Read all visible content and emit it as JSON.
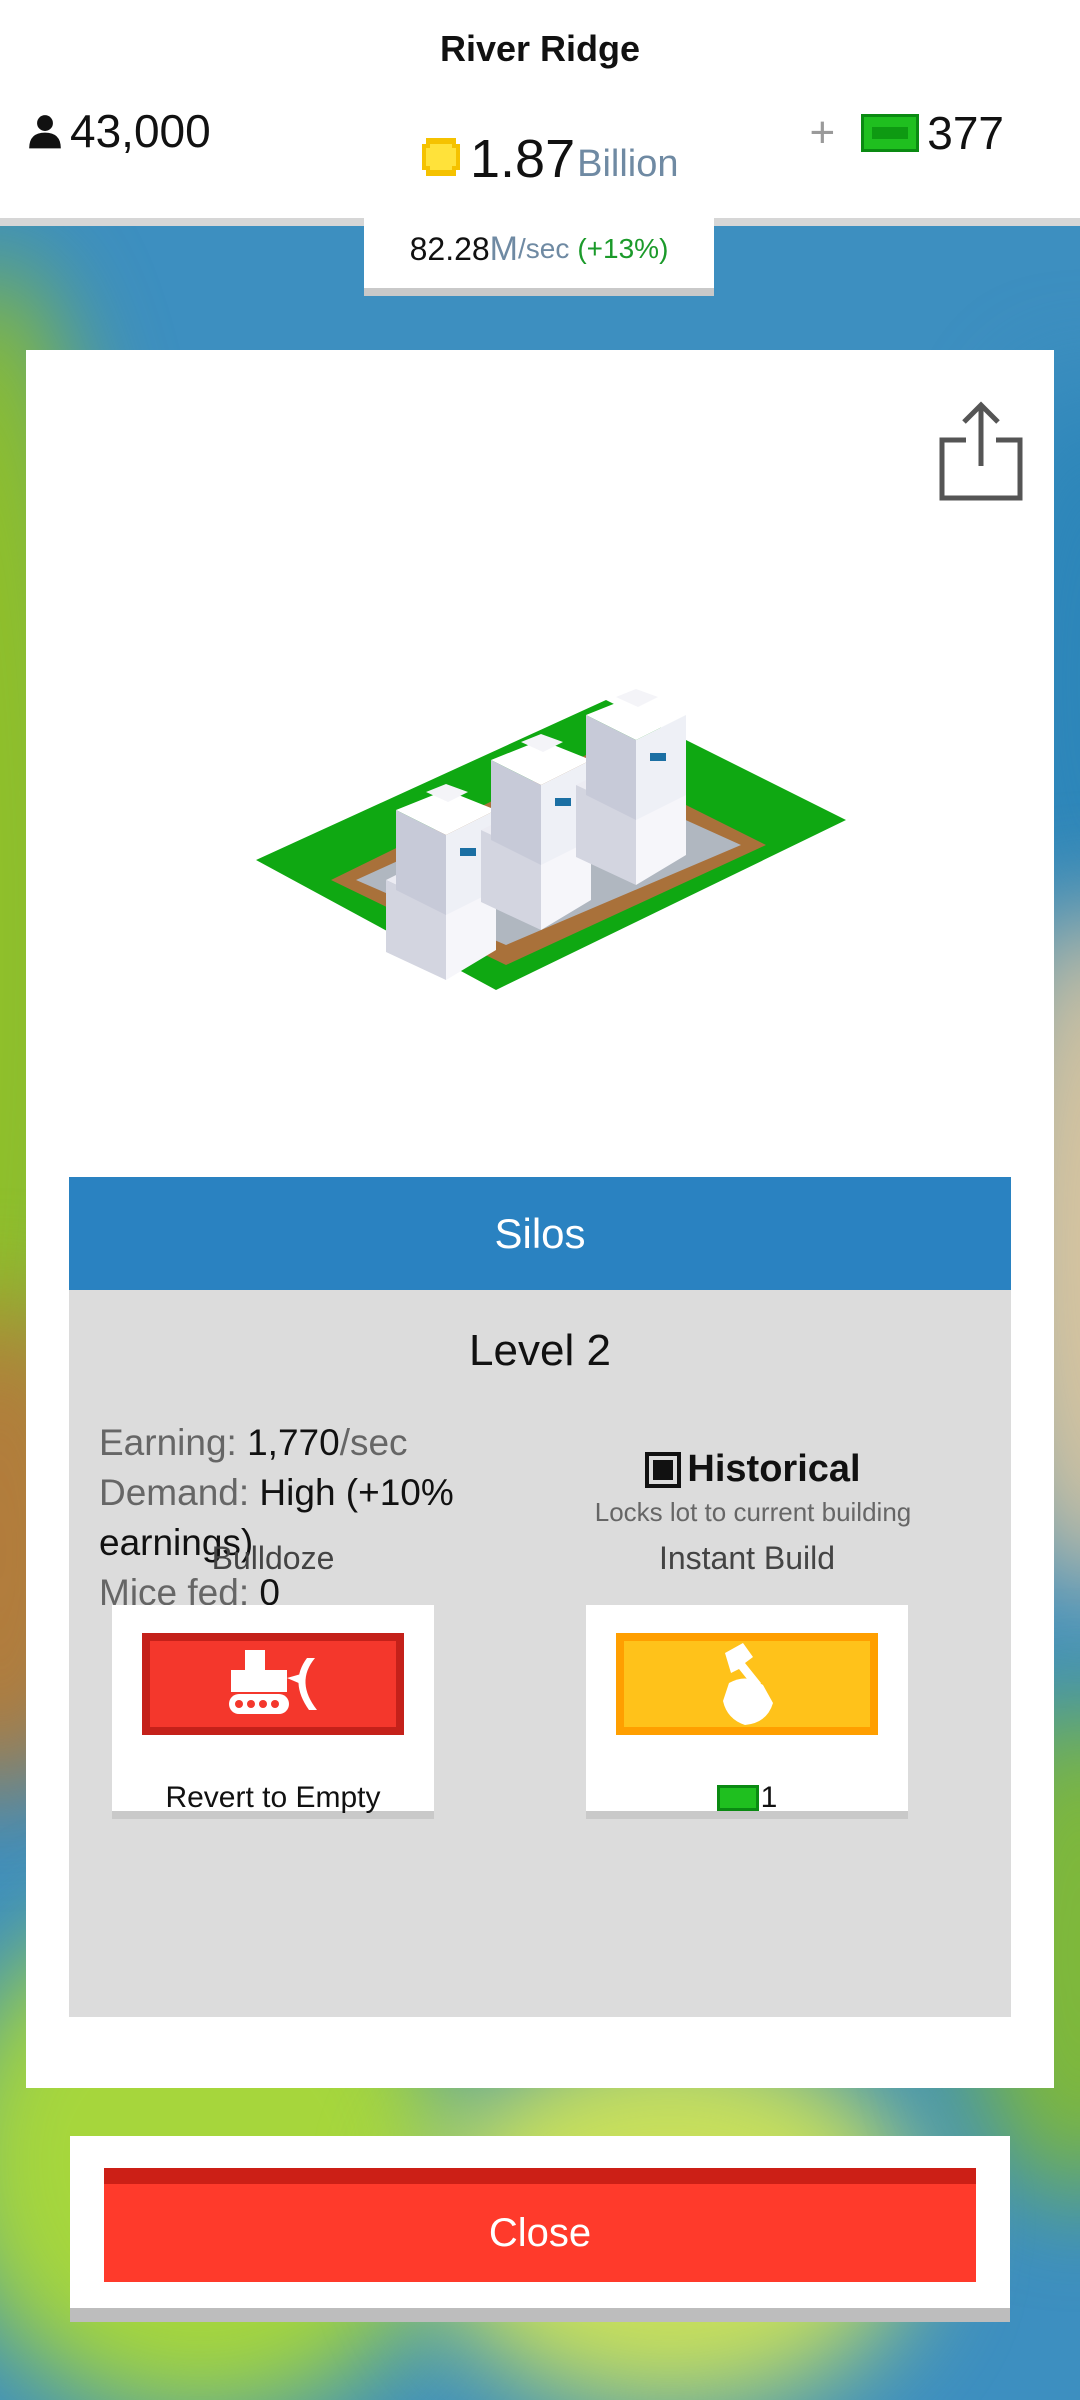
{
  "header": {
    "city_name": "River Ridge",
    "population": "43,000",
    "money_value": "1.87",
    "money_unit": "Billion",
    "premium_plus": "+",
    "premium_count": "377",
    "rate_value": "82.28",
    "rate_unit_m": "M",
    "rate_unit_s": "/sec",
    "rate_change": "(+13%)"
  },
  "building": {
    "name": "Silos",
    "level": "Level 2",
    "earning_label": "Earning: ",
    "earning_value": "1,770",
    "earning_unit": "/sec",
    "demand_label": "Demand: ",
    "demand_value": "High (+10% earnings)",
    "mice_label": "Mice fed: ",
    "mice_value": "0",
    "historical_title": "Historical",
    "historical_desc": "Locks lot to current building",
    "historical_checked": true
  },
  "actions": {
    "bulldoze_label": "Bulldoze",
    "bulldoze_caption": "Revert to Empty",
    "instant_label": "Instant Build",
    "instant_cost": "1"
  },
  "footer": {
    "close_label": "Close"
  },
  "colors": {
    "header_blue": "#2a82c1",
    "close_red": "#ff3a2b",
    "bulldoze_red": "#f4372c",
    "instant_yellow": "#ffc21a",
    "premium_green": "#1fbf1f"
  },
  "icons": {
    "population": "person-icon",
    "money": "coin-icon",
    "premium": "green-bill-icon",
    "share": "share-icon",
    "bulldoze": "bulldozer-icon",
    "instant": "hammer-hand-icon"
  }
}
